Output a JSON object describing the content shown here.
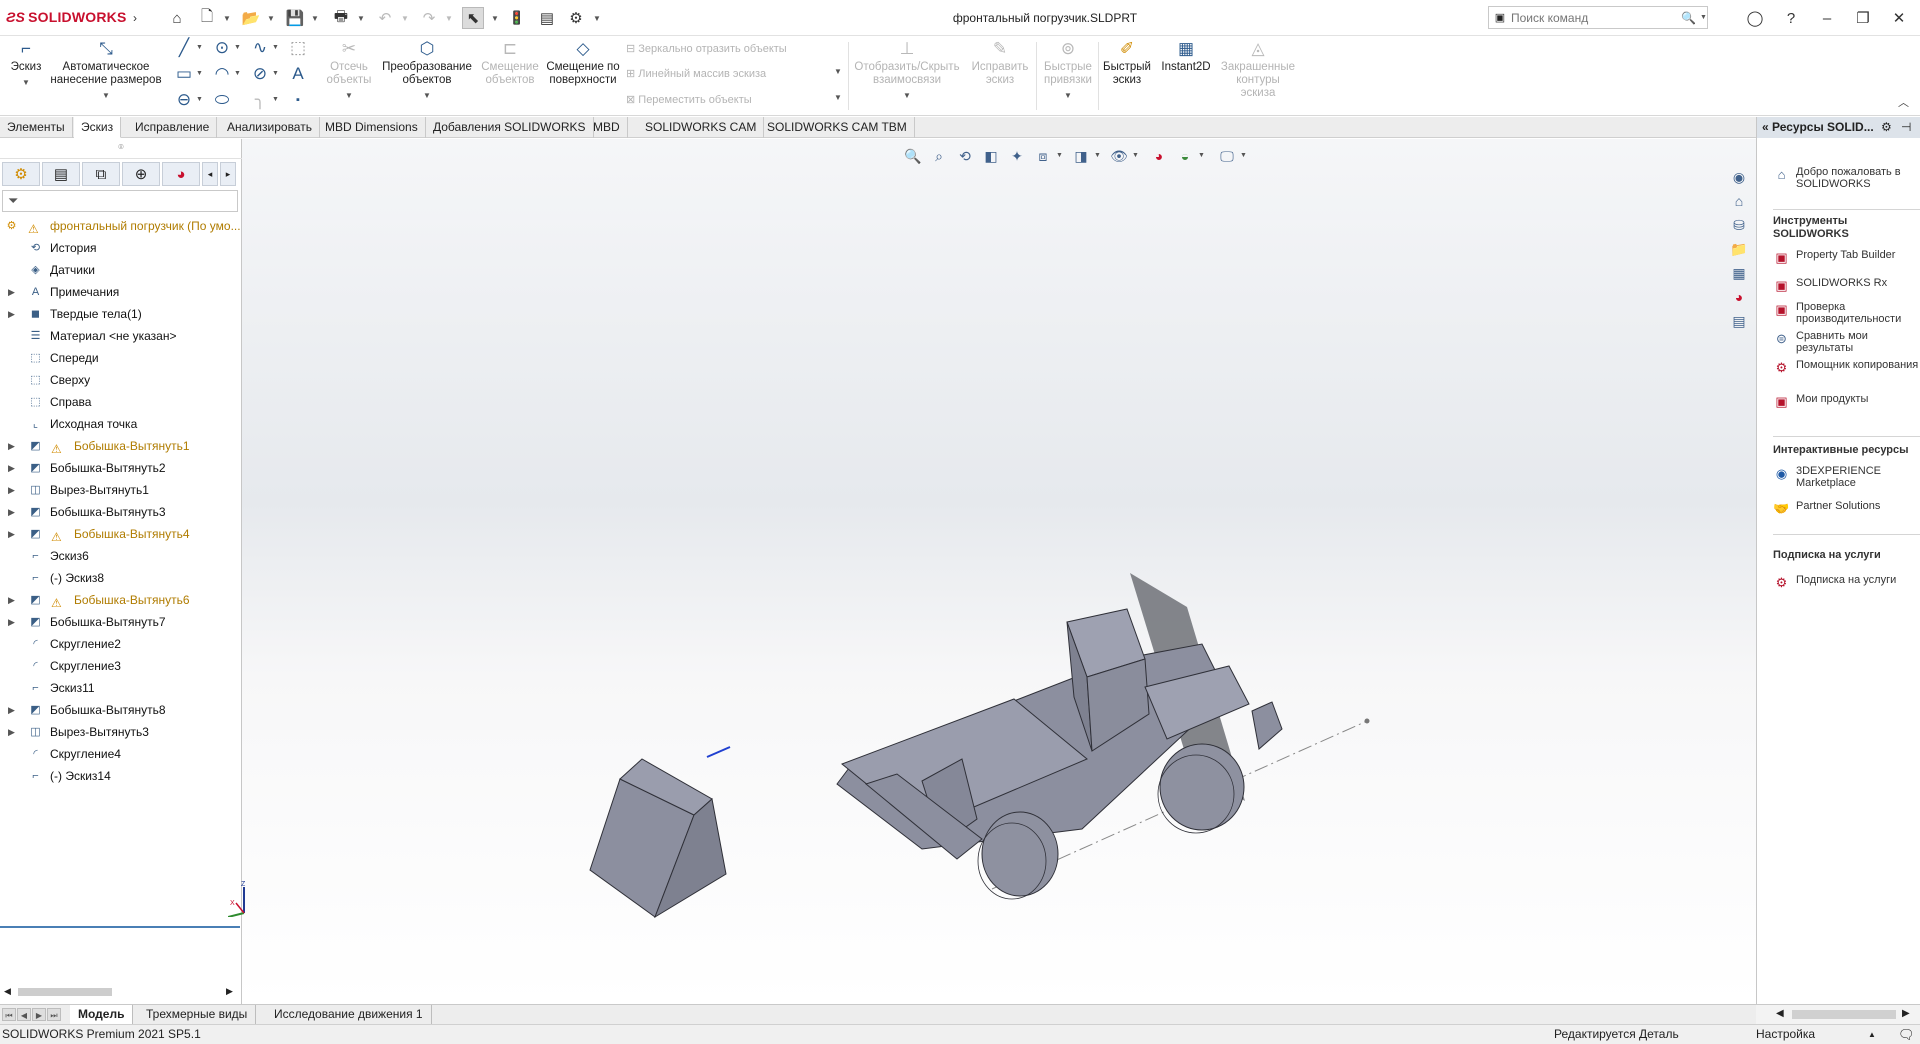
{
  "titlebar": {
    "app_name": "SOLIDWORKS",
    "document_title": "фронтальный погрузчик.SLDPRT",
    "search_placeholder": "Поиск команд"
  },
  "ribbon": {
    "sketch": "Эскиз",
    "smart_dim": "Автоматическое нанесение размеров",
    "trim": "Отсечь объекты",
    "convert": "Преобразование объектов",
    "offset": "Смещение объектов",
    "offset_surface": "Смещение по поверхности",
    "mirror": "Зеркально отразить объекты",
    "linear_pattern": "Линейный массив эскиза",
    "move": "Переместить объекты",
    "relations": "Отобразить/Скрыть взаимосвязи",
    "repair": "Исправить эскиз",
    "quick_snaps": "Быстрые привязки",
    "rapid_sketch": "Быстрый эскиз",
    "instant2d": "Instant2D",
    "shaded_contours": "Закрашенные контуры эскиза"
  },
  "tabs": [
    "Элементы",
    "Эскиз",
    "Исправление",
    "Анализировать",
    "MBD Dimensions",
    "Добавления SOLIDWORKS",
    "MBD",
    "SOLIDWORKS CAM",
    "SOLIDWORKS CAM TBM"
  ],
  "active_tab": "Эскиз",
  "tree": {
    "root": "фронтальный погрузчик  (По умо...",
    "items": [
      {
        "label": "История",
        "icon": "history-icon",
        "expandable": false,
        "warning": false
      },
      {
        "label": "Датчики",
        "icon": "sensor-icon",
        "expandable": false,
        "warning": false
      },
      {
        "label": "Примечания",
        "icon": "annotation-icon",
        "expandable": true,
        "warning": false
      },
      {
        "label": "Твердые тела(1)",
        "icon": "solid-bodies-icon",
        "expandable": true,
        "warning": false
      },
      {
        "label": "Материал <не указан>",
        "icon": "material-icon",
        "expandable": false,
        "warning": false
      },
      {
        "label": "Спереди",
        "icon": "plane-icon",
        "expandable": false,
        "warning": false
      },
      {
        "label": "Сверху",
        "icon": "plane-icon",
        "expandable": false,
        "warning": false
      },
      {
        "label": "Справа",
        "icon": "plane-icon",
        "expandable": false,
        "warning": false
      },
      {
        "label": "Исходная точка",
        "icon": "origin-icon",
        "expandable": false,
        "warning": false
      },
      {
        "label": "Бобышка-Вытянуть1",
        "icon": "extrude-icon",
        "expandable": true,
        "warning": true
      },
      {
        "label": "Бобышка-Вытянуть2",
        "icon": "extrude-icon",
        "expandable": true,
        "warning": false
      },
      {
        "label": "Вырез-Вытянуть1",
        "icon": "cut-icon",
        "expandable": true,
        "warning": false
      },
      {
        "label": "Бобышка-Вытянуть3",
        "icon": "extrude-icon",
        "expandable": true,
        "warning": false
      },
      {
        "label": "Бобышка-Вытянуть4",
        "icon": "extrude-icon",
        "expandable": true,
        "warning": true
      },
      {
        "label": "Эскиз6",
        "icon": "sketch-icon",
        "expandable": false,
        "warning": false
      },
      {
        "label": "(-) Эскиз8",
        "icon": "sketch-icon",
        "expandable": false,
        "warning": false
      },
      {
        "label": "Бобышка-Вытянуть6",
        "icon": "extrude-icon",
        "expandable": true,
        "warning": true
      },
      {
        "label": "Бобышка-Вытянуть7",
        "icon": "extrude-icon",
        "expandable": true,
        "warning": false
      },
      {
        "label": "Скругление2",
        "icon": "fillet-icon",
        "expandable": false,
        "warning": false
      },
      {
        "label": "Скругление3",
        "icon": "fillet-icon",
        "expandable": false,
        "warning": false
      },
      {
        "label": "Эскиз11",
        "icon": "sketch-icon",
        "expandable": false,
        "warning": false
      },
      {
        "label": "Бобышка-Вытянуть8",
        "icon": "extrude-icon",
        "expandable": true,
        "warning": false
      },
      {
        "label": "Вырез-Вытянуть3",
        "icon": "cut-icon",
        "expandable": true,
        "warning": false
      },
      {
        "label": "Скругление4",
        "icon": "fillet-icon",
        "expandable": false,
        "warning": false
      },
      {
        "label": "(-) Эскиз14",
        "icon": "sketch-icon",
        "expandable": false,
        "warning": false
      }
    ]
  },
  "taskpane": {
    "title": "Ресурсы SOLID...",
    "welcome": "Добро пожаловать в SOLIDWORKS",
    "tools_header": "Инструменты SOLIDWORKS",
    "tools": [
      "Property Tab Builder",
      "SOLIDWORKS Rx",
      "Проверка производительности",
      "Сравнить мои результаты",
      "Помощник копирования настроек",
      "Мои продукты"
    ],
    "interactive_header": "Интерактивные ресурсы",
    "interactive": [
      "3DEXPERIENCE Marketplace",
      "Partner Solutions"
    ],
    "subscription_header": "Подписка на услуги",
    "subscription": [
      "Подписка на услуги"
    ]
  },
  "bottom_tabs": [
    "Модель",
    "Трехмерные виды",
    "Исследование движения 1"
  ],
  "status": {
    "left": "SOLIDWORKS Premium 2021 SP5.1",
    "center": "Редактируется Деталь",
    "right": "Настройка"
  },
  "colors": {
    "brand_red": "#c8102e",
    "model_gray": "#8c8f9f",
    "warning_yellow": "#e0a000",
    "selection_blue": "#4a7fb5"
  }
}
